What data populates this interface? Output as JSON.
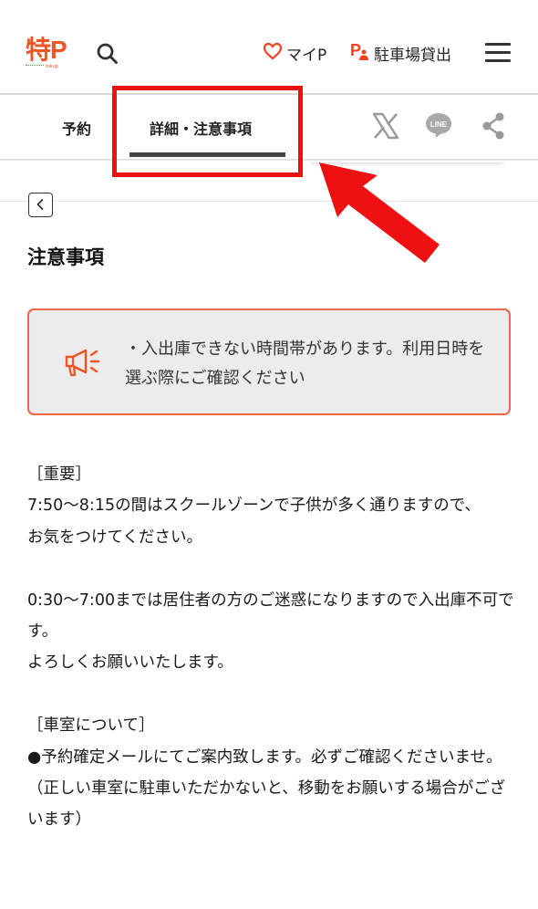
{
  "header": {
    "logo_text": "特P",
    "logo_sub": "tokup",
    "mypage_label": "マイP",
    "rent_label": "駐車場貸出"
  },
  "tabs": [
    {
      "label": "予約"
    },
    {
      "label": "詳細・注意事項"
    }
  ],
  "page": {
    "title": "注意事項"
  },
  "notice": {
    "text": "・入出庫できない時間帯があります。利用日時を選ぶ際にご確認ください"
  },
  "body": {
    "text": "［重要］\n7:50〜8:15の間はスクールゾーンで子供が多く通りますので、\nお気をつけてください。\n\n0:30〜7:00までは居住者の方のご迷惑になりますので入出庫不可です。\nよろしくお願いいたします。\n\n［車室について］\n●予約確定メールにてご案内致します。必ずご確認くださいませ。\n（正しい車室に駐車いただかないと、移動をお願いする場合がございます）"
  },
  "colors": {
    "brand": "#ee5522",
    "highlight": "#ee1111",
    "notice_border": "#ee6644",
    "notice_bg": "#ececec",
    "tab_underline": "#444444"
  },
  "icons": [
    "search-icon",
    "heart-icon",
    "parking-person-icon",
    "hamburger-menu-icon",
    "x-logo-icon",
    "line-logo-icon",
    "share-icon",
    "back-chevron-icon",
    "megaphone-icon"
  ]
}
